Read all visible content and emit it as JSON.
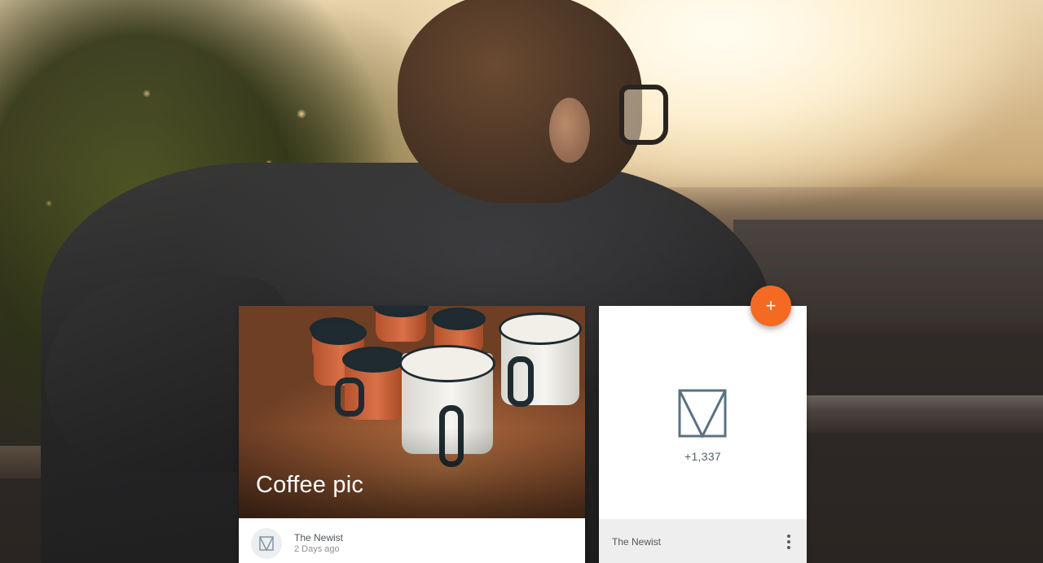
{
  "hero": {
    "description_icon": "hero-photo"
  },
  "fab": {
    "label": "+",
    "color": "#f46a23"
  },
  "image_card": {
    "title": "Coffee pic",
    "author": "The Newist",
    "timestamp": "2 Days ago",
    "avatar_icon": "newist-logo-icon"
  },
  "logo_card": {
    "logo_icon": "newist-logo-icon",
    "count": "+1,337",
    "author": "The Newist",
    "menu_icon": "more-vert-icon"
  }
}
